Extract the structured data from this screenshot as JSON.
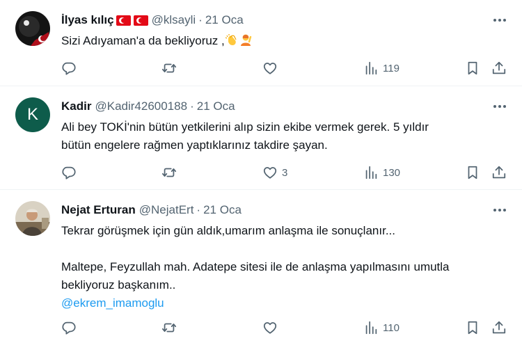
{
  "tweets": [
    {
      "name": "İlyas kılıç",
      "handle": "@klsayli",
      "sep": "·",
      "date": "21 Oca",
      "lines": [
        "Sizi Adıyaman'a da bekliyoruz ,"
      ],
      "counts": {
        "reply": "",
        "retweet": "",
        "like": "",
        "views": "119"
      }
    },
    {
      "name": "Kadir",
      "handle": "@Kadir42600188",
      "sep": "·",
      "date": "21 Oca",
      "avatar_letter": "K",
      "lines": [
        "Ali bey TOKİ'nin bütün yetkilerini alıp sizin ekibe vermek gerek. 5 yıldır",
        "bütün engelere rağmen yaptıklarınız takdire şayan."
      ],
      "counts": {
        "reply": "",
        "retweet": "",
        "like": "3",
        "views": "130"
      }
    },
    {
      "name": "Nejat Erturan",
      "handle": "@NejatErt",
      "sep": "·",
      "date": "21 Oca",
      "lines": [
        "Tekrar görüşmek için gün aldık,umarım anlaşma ile sonuçlanır...",
        "Maltepe, Feyzullah mah. Adatepe sitesi ile de anlaşma yapılmasını umutla",
        "bekliyoruz başkanım.."
      ],
      "mention": "@ekrem_imamoglu",
      "counts": {
        "reply": "",
        "retweet": "",
        "like": "",
        "views": "110"
      }
    }
  ],
  "colors": {
    "text": "#0f1419",
    "secondary": "#536471",
    "link": "#1d9bf0",
    "divider": "#eff3f4",
    "avatar_green": "#0e5c4b",
    "flag_red": "#e30a17"
  },
  "icons": [
    "reply-icon",
    "retweet-icon",
    "like-icon",
    "views-icon",
    "bookmark-icon",
    "share-icon",
    "more-icon",
    "clapping-hands-emoji",
    "person-raising-hand-emoji"
  ]
}
